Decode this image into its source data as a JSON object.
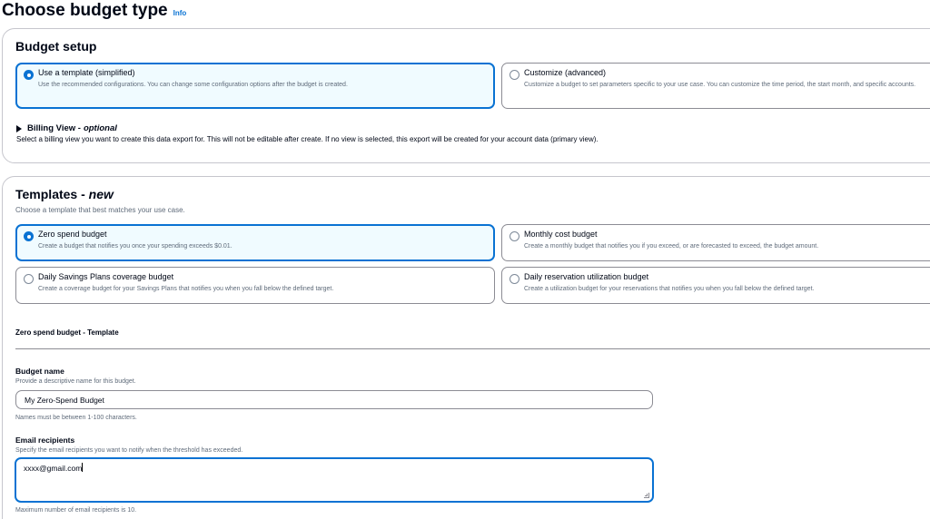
{
  "page": {
    "title": "Choose budget type",
    "info_link": "Info"
  },
  "budget_setup": {
    "heading": "Budget setup",
    "options": [
      {
        "title": "Use a template (simplified)",
        "description": "Use the recommended configurations. You can change some configuration options after the budget is created.",
        "selected": true
      },
      {
        "title": "Customize (advanced)",
        "description": "Customize a budget to set parameters specific to your use case. You can customize the time period, the start month, and specific accounts.",
        "selected": false
      }
    ],
    "billing_view": {
      "label": "Billing View -",
      "optional": "optional",
      "description": "Select a billing view you want to create this data export for. This will not be editable after create. If no view is selected, this export will be created for your account data (primary view)."
    }
  },
  "templates": {
    "heading": "Templates -",
    "heading_badge": "new",
    "subtext": "Choose a template that best matches your use case.",
    "options": [
      {
        "title": "Zero spend budget",
        "description": "Create a budget that notifies you once your spending exceeds $0.01.",
        "selected": true
      },
      {
        "title": "Monthly cost budget",
        "description": "Create a monthly budget that notifies you if you exceed, or are forecasted to exceed, the budget amount.",
        "selected": false
      },
      {
        "title": "Daily Savings Plans coverage budget",
        "description": "Create a coverage budget for your Savings Plans that notifies you when you fall below the defined target.",
        "selected": false
      },
      {
        "title": "Daily reservation utilization budget",
        "description": "Create a utilization budget for your reservations that notifies you when you fall below the defined target.",
        "selected": false
      }
    ],
    "template_heading": "Zero spend budget - Template",
    "budget_name": {
      "label": "Budget name",
      "description": "Provide a descriptive name for this budget.",
      "value": "My Zero-Spend Budget",
      "constraint": "Names must be between 1-100 characters."
    },
    "email_recipients": {
      "label": "Email recipients",
      "description": "Specify the email recipients you want to notify when the threshold has exceeded.",
      "value": "xxxx@gmail.com",
      "constraint": "Maximum number of email recipients is 10."
    }
  },
  "colors": {
    "accent": "#0972d3",
    "selected_bg": "#f0fbff",
    "border": "#8c8c94",
    "muted_text": "#5f6b7a"
  }
}
